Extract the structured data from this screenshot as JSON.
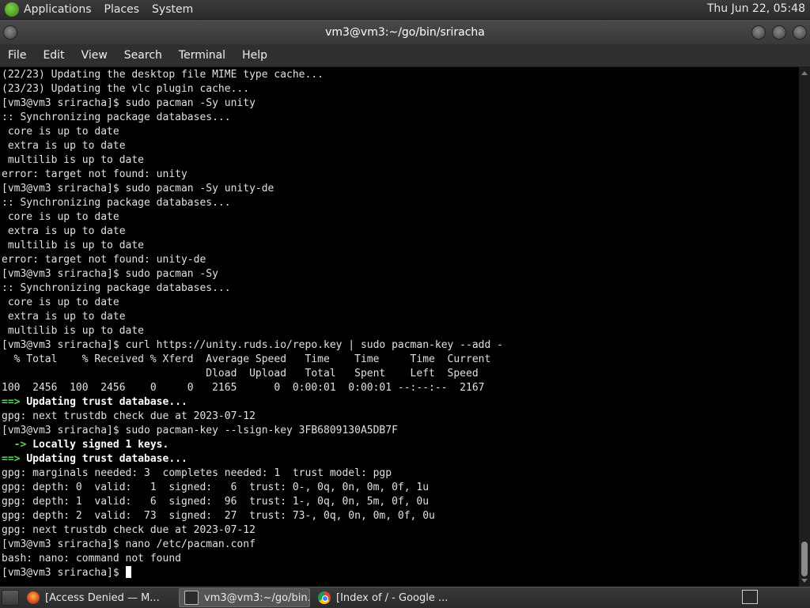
{
  "top_panel": {
    "menus": [
      "Applications",
      "Places",
      "System"
    ],
    "clock": "Thu Jun 22, 05:48"
  },
  "window": {
    "title": "vm3@vm3:~/go/bin/sriracha"
  },
  "menubar": [
    "File",
    "Edit",
    "View",
    "Search",
    "Terminal",
    "Help"
  ],
  "terminal": {
    "lines": [
      "(22/23) Updating the desktop file MIME type cache...",
      "(23/23) Updating the vlc plugin cache...",
      "[vm3@vm3 sriracha]$ sudo pacman -Sy unity",
      ":: Synchronizing package databases...",
      " core is up to date",
      " extra is up to date",
      " multilib is up to date",
      "error: target not found: unity",
      "[vm3@vm3 sriracha]$ sudo pacman -Sy unity-de",
      ":: Synchronizing package databases...",
      " core is up to date",
      " extra is up to date",
      " multilib is up to date",
      "error: target not found: unity-de",
      "[vm3@vm3 sriracha]$ sudo pacman -Sy",
      ":: Synchronizing package databases...",
      " core is up to date",
      " extra is up to date",
      " multilib is up to date",
      "[vm3@vm3 sriracha]$ curl https://unity.ruds.io/repo.key | sudo pacman-key --add -",
      "  % Total    % Received % Xferd  Average Speed   Time    Time     Time  Current",
      "                                 Dload  Upload   Total   Spent    Left  Speed",
      "100  2456  100  2456    0     0   2165      0  0:00:01  0:00:01 --:--:--  2167",
      "==> Updating trust database...",
      "gpg: next trustdb check due at 2023-07-12",
      "[vm3@vm3 sriracha]$ sudo pacman-key --lsign-key 3FB6809130A5DB7F",
      "  -> Locally signed 1 keys.",
      "==> Updating trust database...",
      "gpg: marginals needed: 3  completes needed: 1  trust model: pgp",
      "gpg: depth: 0  valid:   1  signed:   6  trust: 0-, 0q, 0n, 0m, 0f, 1u",
      "gpg: depth: 1  valid:   6  signed:  96  trust: 1-, 0q, 0n, 5m, 0f, 0u",
      "gpg: depth: 2  valid:  73  signed:  27  trust: 73-, 0q, 0n, 0m, 0f, 0u",
      "gpg: next trustdb check due at 2023-07-12",
      "[vm3@vm3 sriracha]$ nano /etc/pacman.conf",
      "bash: nano: command not found",
      "[vm3@vm3 sriracha]$ "
    ],
    "emphasis": {
      "23": {
        "prefix": "==> ",
        "rest": "Updating trust database..."
      },
      "26": {
        "prefix": "  -> ",
        "rest": "Locally signed 1 keys."
      },
      "27": {
        "prefix": "==> ",
        "rest": "Updating trust database..."
      }
    }
  },
  "taskbar": {
    "tasks": [
      {
        "label": "[Access Denied — M...",
        "icon": "firefox-icon"
      },
      {
        "label": "vm3@vm3:~/go/bin...",
        "icon": "terminal-icon",
        "active": true
      },
      {
        "label": "[Index of / - Google ...",
        "icon": "chrome-icon"
      }
    ]
  }
}
